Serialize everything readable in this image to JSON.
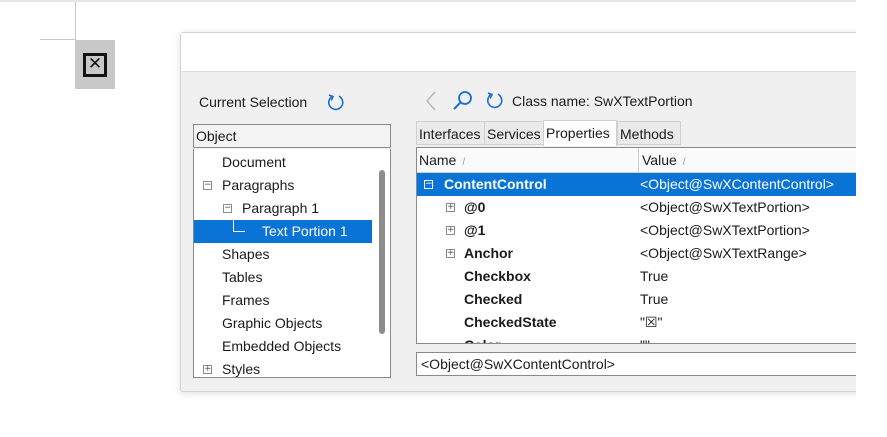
{
  "document": {
    "content_control_glyph": "✕"
  },
  "inspector": {
    "current_selection_label": "Current Selection",
    "tree_header": "Object",
    "tree_items": [
      {
        "label": "Document"
      },
      {
        "label": "Paragraphs",
        "expander": "−"
      },
      {
        "label": "Paragraph 1",
        "expander": "−"
      },
      {
        "label": "Text Portion 1",
        "selected": true
      },
      {
        "label": "Shapes"
      },
      {
        "label": "Tables"
      },
      {
        "label": "Frames"
      },
      {
        "label": "Graphic Objects"
      },
      {
        "label": "Embedded Objects"
      },
      {
        "label": "Styles",
        "expander": "+"
      }
    ],
    "class_name_label": "Class name:",
    "class_name_value": "SwXTextPortion",
    "tabs": [
      {
        "label": "Interfaces"
      },
      {
        "label": "Services"
      },
      {
        "label": "Properties",
        "active": true
      },
      {
        "label": "Methods"
      }
    ],
    "columns": {
      "name": "Name",
      "value": "Value"
    },
    "properties": [
      {
        "name": "ContentControl",
        "value": "<Object@SwXContentControl>",
        "expander": "−",
        "selected": true
      },
      {
        "name": "@0",
        "value": "<Object@SwXTextPortion>",
        "expander": "+"
      },
      {
        "name": "@1",
        "value": "<Object@SwXTextPortion>",
        "expander": "+"
      },
      {
        "name": "Anchor",
        "value": "<Object@SwXTextRange>",
        "expander": "+"
      },
      {
        "name": "Checkbox",
        "value": "True"
      },
      {
        "name": "Checked",
        "value": "True"
      },
      {
        "name": "CheckedState",
        "value": "\"☒\""
      },
      {
        "name": "Color",
        "value": "\"\""
      }
    ],
    "selected_value": "<Object@SwXContentControl>"
  }
}
